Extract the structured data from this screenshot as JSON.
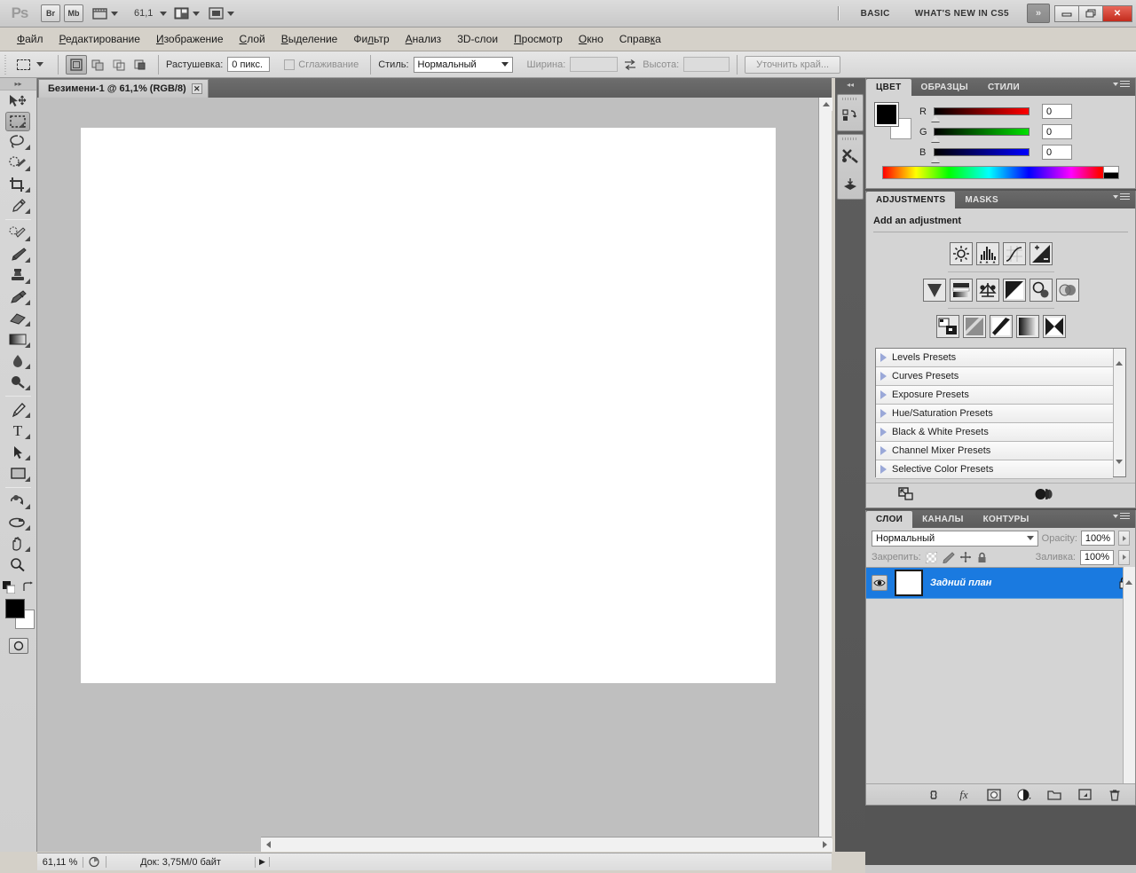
{
  "app": {
    "name": "Adobe Photoshop CS5",
    "logo_text": "Ps"
  },
  "titlebar": {
    "bridge_label": "Br",
    "minibridge_label": "Mb",
    "view_extras_icon": "view-extras-icon",
    "zoom_value": "61,1",
    "screen_mode_icon": "screen-mode-icon",
    "arrange_icon": "arrange-documents-icon",
    "workspace_basic": "BASIC",
    "workspace_whatsnew": "WHAT'S NEW IN CS5",
    "more_chevron": "»",
    "minimize": "─",
    "maximize": "❐",
    "close": "✕"
  },
  "menubar": {
    "items": [
      {
        "pre": "",
        "hot": "Ф",
        "post": "айл",
        "name": "menu-file"
      },
      {
        "pre": "",
        "hot": "Р",
        "post": "едактирование",
        "name": "menu-edit"
      },
      {
        "pre": "",
        "hot": "И",
        "post": "зображение",
        "name": "menu-image"
      },
      {
        "pre": "",
        "hot": "С",
        "post": "лой",
        "name": "menu-layer"
      },
      {
        "pre": "",
        "hot": "В",
        "post": "ыделение",
        "name": "menu-select"
      },
      {
        "pre": "Фи",
        "hot": "л",
        "post": "ьтр",
        "name": "menu-filter"
      },
      {
        "pre": "",
        "hot": "А",
        "post": "нализ",
        "name": "menu-analysis"
      },
      {
        "pre": "3D-слои",
        "hot": "",
        "post": "",
        "name": "menu-3d"
      },
      {
        "pre": "",
        "hot": "П",
        "post": "росмотр",
        "name": "menu-view"
      },
      {
        "pre": "",
        "hot": "О",
        "post": "кно",
        "name": "menu-window"
      },
      {
        "pre": "Справ",
        "hot": "к",
        "post": "а",
        "name": "menu-help"
      }
    ]
  },
  "optionsbar": {
    "tool_preset_icon": "rectangular-marquee-icon",
    "selection_modes": [
      "new-selection",
      "add-to-selection",
      "subtract-from-selection",
      "intersect-selection"
    ],
    "feather_label": "Растушевка:",
    "feather_value": "0 пикс.",
    "antialias_label": "Сглаживание",
    "style_label": "Стиль:",
    "style_value": "Нормальный",
    "width_label": "Ширина:",
    "width_value": "",
    "height_label": "Высота:",
    "height_value": "",
    "swap_icon": "swap-width-height-icon",
    "refine_edge_label": "Уточнить край..."
  },
  "toolbar": {
    "collapse_icon": "collapse-panel-icon",
    "tools": [
      {
        "name": "move-tool",
        "icon": "move",
        "has_flyout": false,
        "selected": false
      },
      {
        "name": "rectangular-marquee-tool",
        "icon": "marquee",
        "has_flyout": true,
        "selected": true
      },
      {
        "name": "lasso-tool",
        "icon": "lasso",
        "has_flyout": true,
        "selected": false
      },
      {
        "name": "quick-selection-tool",
        "icon": "quickselect",
        "has_flyout": true,
        "selected": false
      },
      {
        "name": "crop-tool",
        "icon": "crop",
        "has_flyout": true,
        "selected": false
      },
      {
        "name": "eyedropper-tool",
        "icon": "eyedropper",
        "has_flyout": true,
        "selected": false
      },
      {
        "name": "spot-healing-brush-tool",
        "icon": "healing",
        "has_flyout": true,
        "selected": false
      },
      {
        "name": "brush-tool",
        "icon": "brush",
        "has_flyout": true,
        "selected": false
      },
      {
        "name": "clone-stamp-tool",
        "icon": "stamp",
        "has_flyout": true,
        "selected": false
      },
      {
        "name": "history-brush-tool",
        "icon": "historybrush",
        "has_flyout": true,
        "selected": false
      },
      {
        "name": "eraser-tool",
        "icon": "eraser",
        "has_flyout": true,
        "selected": false
      },
      {
        "name": "gradient-tool",
        "icon": "gradient",
        "has_flyout": true,
        "selected": false
      },
      {
        "name": "blur-tool",
        "icon": "blur",
        "has_flyout": true,
        "selected": false
      },
      {
        "name": "dodge-tool",
        "icon": "dodge",
        "has_flyout": true,
        "selected": false
      },
      {
        "name": "pen-tool",
        "icon": "pen",
        "has_flyout": true,
        "selected": false
      },
      {
        "name": "horizontal-type-tool",
        "icon": "type",
        "has_flyout": true,
        "selected": false
      },
      {
        "name": "path-selection-tool",
        "icon": "pathselect",
        "has_flyout": true,
        "selected": false
      },
      {
        "name": "rectangle-tool",
        "icon": "shape",
        "has_flyout": true,
        "selected": false
      },
      {
        "name": "3d-object-rotate-tool",
        "icon": "rotate3d",
        "has_flyout": true,
        "selected": false
      },
      {
        "name": "3d-camera-rotate-tool",
        "icon": "camera3d",
        "has_flyout": true,
        "selected": false
      },
      {
        "name": "hand-tool",
        "icon": "hand",
        "has_flyout": true,
        "selected": false
      },
      {
        "name": "zoom-tool",
        "icon": "zoom",
        "has_flyout": false,
        "selected": false
      }
    ],
    "default_colors_icon": "default-colors-icon",
    "swap_colors_icon": "swap-colors-icon",
    "foreground_color": "#000000",
    "background_color": "#ffffff",
    "quickmask_icon": "quick-mask-mode-icon"
  },
  "document": {
    "tab_title": "Безимени-1 @ 61,1% (RGB/8)",
    "close_glyph": "✕",
    "canvas_color": "#ffffff"
  },
  "statusbar": {
    "zoom": "61,11 %",
    "proxy_icon": "document-proxy-icon",
    "doc_info": "Док: 3,75М/0 байт",
    "expand_arrow": "▶"
  },
  "icon_dock": {
    "collapse_icon": "expand-panels-icon",
    "groups": [
      {
        "name": "history-actions-dock-icon"
      },
      {
        "name": "tool-presets-dock-icon"
      },
      {
        "name": "3d-dock-icon"
      }
    ]
  },
  "color_panel": {
    "tabs": [
      {
        "label": "ЦВЕТ",
        "name": "tab-color",
        "active": true
      },
      {
        "label": "ОБРАЗЦЫ",
        "name": "tab-swatches",
        "active": false
      },
      {
        "label": "СТИЛИ",
        "name": "tab-styles",
        "active": false
      }
    ],
    "menu_icon": "panel-menu-icon",
    "foreground": "#000000",
    "background": "#ffffff",
    "channels": [
      {
        "label": "R",
        "value": "0",
        "color": "#ff0000"
      },
      {
        "label": "G",
        "value": "0",
        "color": "#00e000"
      },
      {
        "label": "B",
        "value": "0",
        "color": "#0000ff"
      }
    ],
    "spectrum_name": "color-ramp"
  },
  "adjustments_panel": {
    "tabs": [
      {
        "label": "ADJUSTMENTS",
        "name": "tab-adjustments",
        "active": true
      },
      {
        "label": "MASKS",
        "name": "tab-masks",
        "active": false
      }
    ],
    "menu_icon": "panel-menu-icon",
    "title": "Add an adjustment",
    "row1": [
      "brightness-contrast-icon",
      "levels-icon",
      "curves-icon",
      "exposure-icon"
    ],
    "row2": [
      "vibrance-icon",
      "hue-saturation-icon",
      "color-balance-icon",
      "black-and-white-icon",
      "photo-filter-icon",
      "channel-mixer-icon"
    ],
    "row3": [
      "invert-icon",
      "posterize-icon",
      "threshold-icon",
      "gradient-map-icon",
      "selective-color-icon"
    ],
    "presets": [
      "Levels Presets",
      "Curves Presets",
      "Exposure Presets",
      "Hue/Saturation Presets",
      "Black & White Presets",
      "Channel Mixer Presets",
      "Selective Color Presets"
    ],
    "footer_left_icon": "expand-view-icon",
    "footer_right_icon": "clip-to-layer-icon"
  },
  "layers_panel": {
    "tabs": [
      {
        "label": "СЛОИ",
        "name": "tab-layers",
        "active": true
      },
      {
        "label": "КАНАЛЫ",
        "name": "tab-channels",
        "active": false
      },
      {
        "label": "КОНТУРЫ",
        "name": "tab-paths",
        "active": false
      }
    ],
    "menu_icon": "panel-menu-icon",
    "blend_mode": "Нормальный",
    "opacity_label": "Opacity:",
    "opacity_value": "100%",
    "lock_label": "Закрепить:",
    "fill_label": "Заливка:",
    "fill_value": "100%",
    "lock_icons": [
      "lock-transparent-pixels-icon",
      "lock-image-pixels-icon",
      "lock-position-icon",
      "lock-all-icon"
    ],
    "layers": [
      {
        "name": "Задний план",
        "visible": true,
        "locked": true,
        "selected": true,
        "thumb_color": "#ffffff"
      }
    ],
    "footer_icons": [
      "link-layers-icon",
      "layer-style-fx-icon",
      "add-layer-mask-icon",
      "new-adjustment-layer-icon",
      "new-group-icon",
      "new-layer-icon",
      "delete-layer-icon"
    ]
  },
  "colors": {
    "accent_selection": "#1a7ae0",
    "panel_bg": "#d4d4d4",
    "chrome_dark": "#5e5e5e",
    "canvas_bg": "#bfbfbf",
    "close_button": "#c32b1c"
  }
}
